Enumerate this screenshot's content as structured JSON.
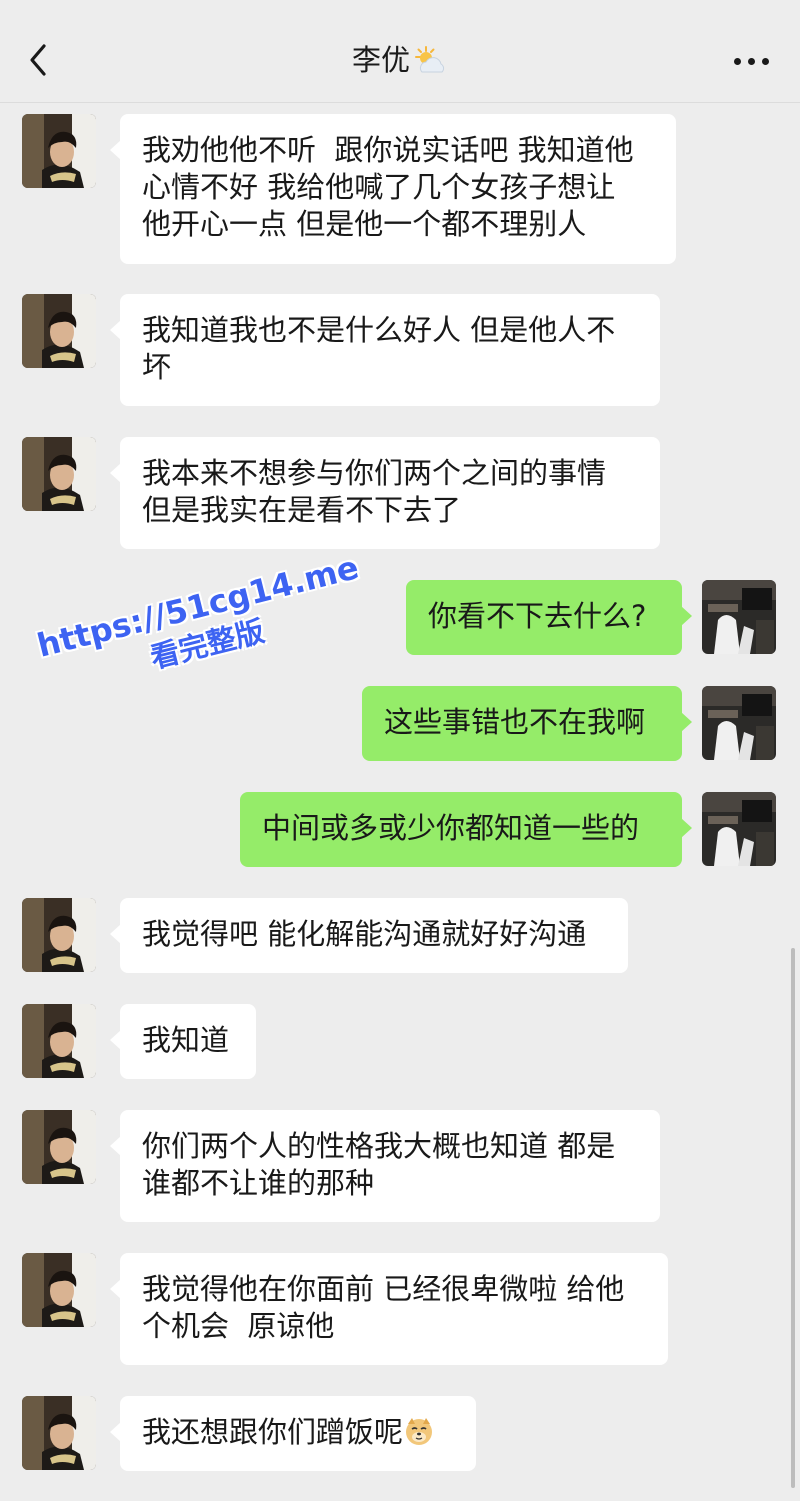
{
  "header": {
    "title": "李优",
    "weather_icon": "sun-behind-cloud-icon",
    "back_icon": "chevron-left-icon",
    "more_icon": "ellipsis-icon"
  },
  "messages": [
    {
      "side": "in",
      "text": "我劝他他不听  跟你说实话吧 我知道他\n心情不好 我给他喊了几个女孩子想让\n他开心一点 但是他一个都不理别人"
    },
    {
      "side": "in",
      "text": "我知道我也不是什么好人 但是他人不\n坏"
    },
    {
      "side": "in",
      "text": "我本来不想参与你们两个之间的事情\n但是我实在是看不下去了"
    },
    {
      "side": "out",
      "text": "你看不下去什么?"
    },
    {
      "side": "out",
      "text": "这些事错也不在我啊"
    },
    {
      "side": "out",
      "text": "中间或多或少你都知道一些的"
    },
    {
      "side": "in",
      "text": "我觉得吧 能化解能沟通就好好沟通"
    },
    {
      "side": "in",
      "text": "我知道"
    },
    {
      "side": "in",
      "text": "你们两个人的性格我大概也知道 都是\n谁都不让谁的那种"
    },
    {
      "side": "in",
      "text": "我觉得他在你面前 已经很卑微啦 给他\n个机会  原谅他"
    },
    {
      "side": "in",
      "text": "我还想跟你们蹭饭呢",
      "emoji": "doge-emoji-icon"
    }
  ],
  "watermark": {
    "url": "https://51cg14.me",
    "sub": "看完整版"
  },
  "colors": {
    "background": "#ededed",
    "incoming_bubble": "#ffffff",
    "outgoing_bubble": "#95ec69",
    "watermark": "#3d63f2"
  }
}
